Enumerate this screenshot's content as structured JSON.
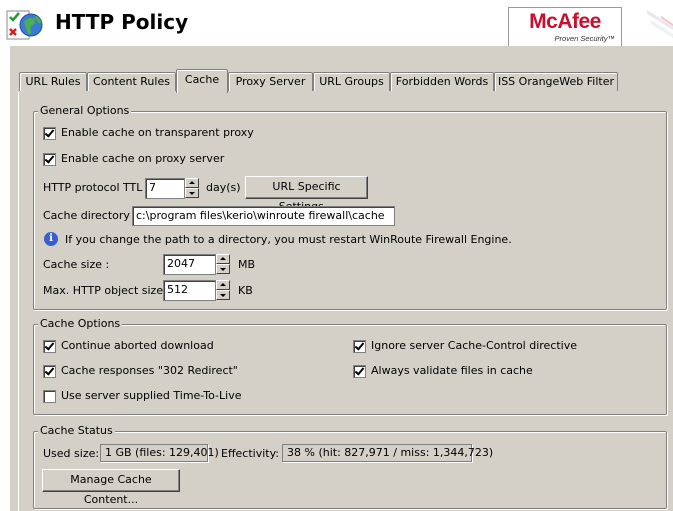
{
  "header": {
    "title": "HTTP Policy",
    "logo": {
      "brand": "McAfee",
      "tagline": "Proven Security™"
    }
  },
  "tabs": [
    {
      "label": "URL Rules",
      "active": false
    },
    {
      "label": "Content Rules",
      "active": false
    },
    {
      "label": "Cache",
      "active": true
    },
    {
      "label": "Proxy Server",
      "active": false
    },
    {
      "label": "URL Groups",
      "active": false
    },
    {
      "label": "Forbidden Words",
      "active": false
    },
    {
      "label": "ISS OrangeWeb Filter",
      "active": false
    }
  ],
  "general": {
    "legend": "General Options",
    "transparent_label": "Enable cache on transparent proxy",
    "transparent_checked": true,
    "proxy_label": "Enable cache on proxy server",
    "proxy_checked": true,
    "ttl_label": "HTTP protocol TTL :",
    "ttl_value": "7",
    "ttl_unit": "day(s)",
    "url_specific_button": "URL Specific Settings...",
    "dir_label": "Cache directory :",
    "dir_value": "c:\\program files\\kerio\\winroute firewall\\cache",
    "info_text": "If you change the path to a directory, you must restart WinRoute Firewall Engine.",
    "size_label": "Cache size :",
    "size_value": "2047",
    "size_unit": "MB",
    "max_label": "Max. HTTP object size :",
    "max_value": "512",
    "max_unit": "KB"
  },
  "cache_options": {
    "legend": "Cache Options",
    "continue_label": "Continue aborted download",
    "continue_checked": true,
    "redirect_label": "Cache responses \"302 Redirect\"",
    "redirect_checked": true,
    "server_ttl_label": "Use server supplied Time-To-Live",
    "server_ttl_checked": false,
    "ignore_label": "Ignore server Cache-Control directive",
    "ignore_checked": true,
    "validate_label": "Always validate files in cache",
    "validate_checked": true
  },
  "status": {
    "legend": "Cache Status",
    "used_label": "Used size:",
    "used_value": "1 GB (files: 129,401)",
    "eff_label": "Effectivity:",
    "eff_value": "38 % (hit: 827,971 / miss: 1,344,723)",
    "manage_button": "Manage Cache Content..."
  },
  "colors": {
    "panel": "#d4d0c8",
    "brand": "#c8102e",
    "info": "#3a5fcd"
  }
}
